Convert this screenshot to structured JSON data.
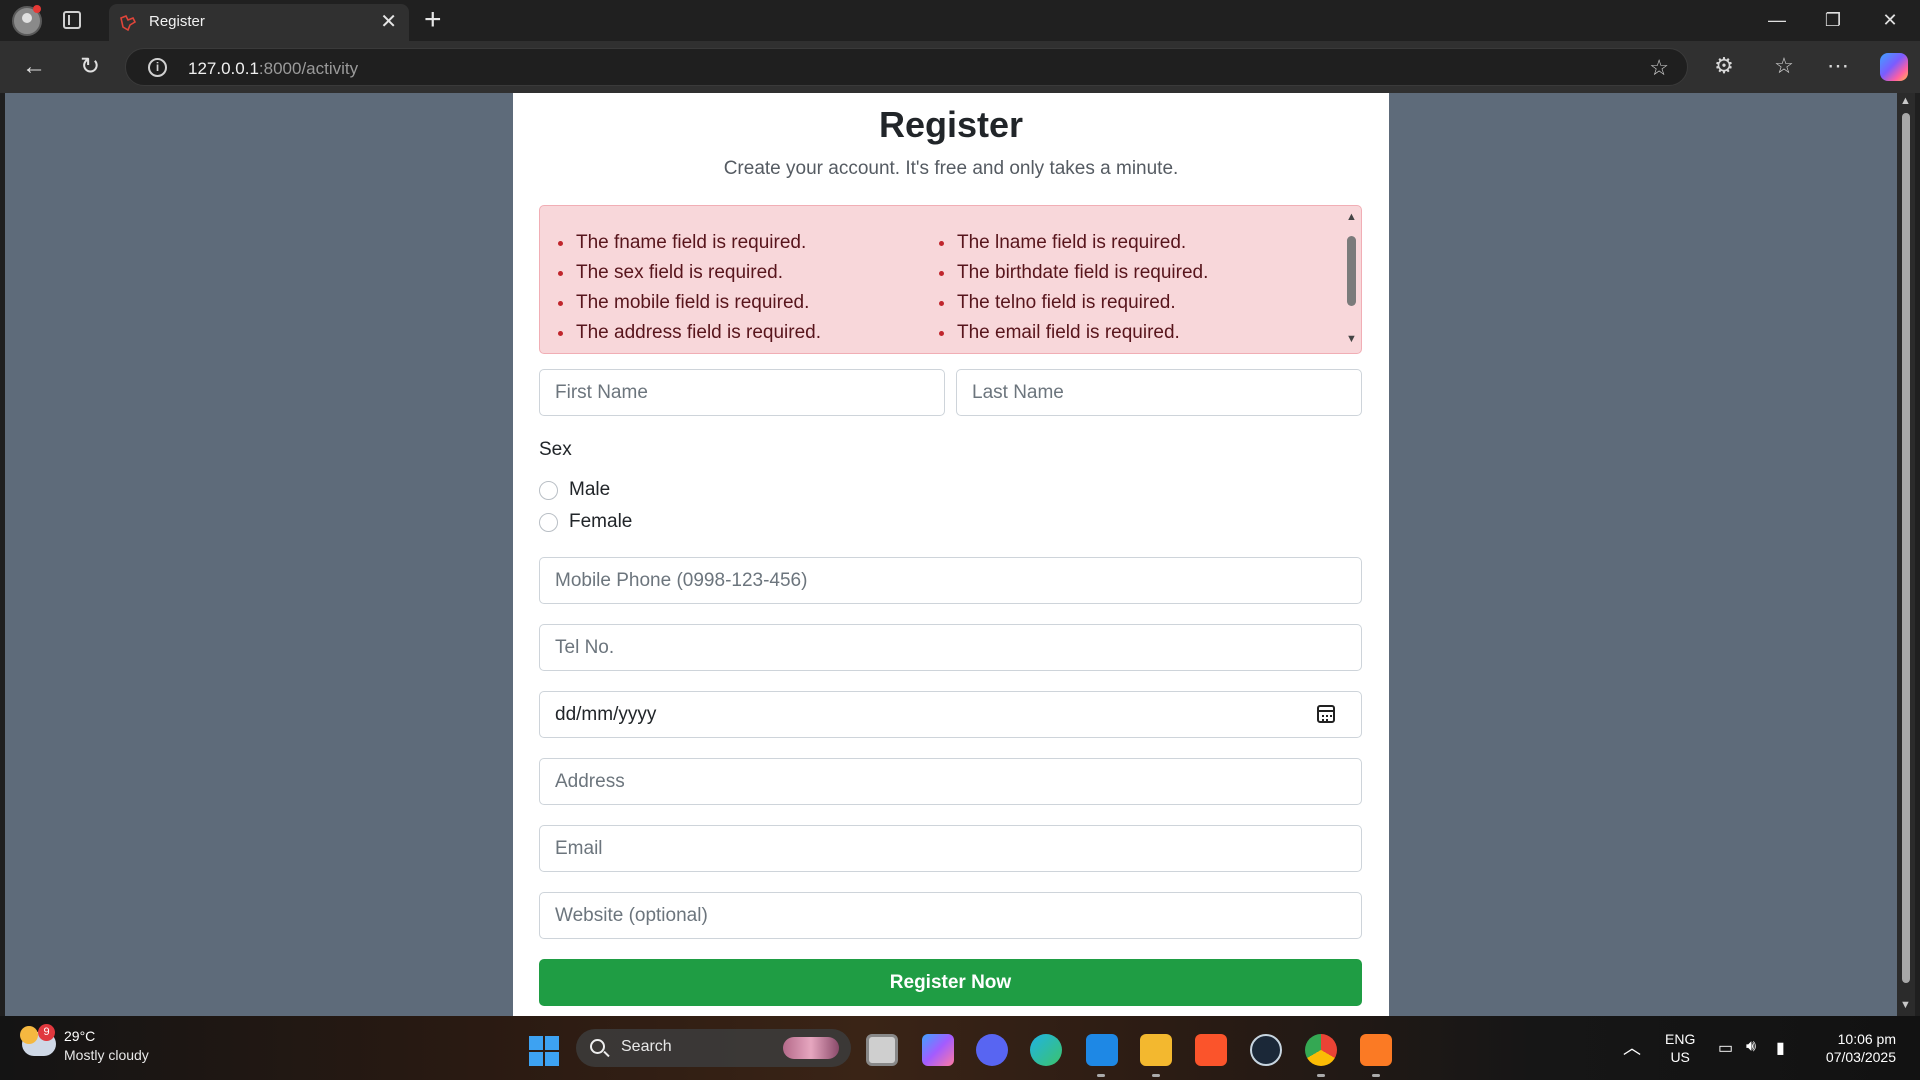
{
  "browser": {
    "tab_title": "Register",
    "url_host": "127.0.0.1",
    "url_path": ":8000/activity"
  },
  "page": {
    "title": "Register",
    "subtitle": "Create your account. It's free and only takes a minute.",
    "errors_left": [
      "The fname field is required.",
      "The sex field is required.",
      "The mobile field is required.",
      "The address field is required."
    ],
    "errors_right": [
      "The lname field is required.",
      "The birthdate field is required.",
      "The telno field is required.",
      "The email field is required."
    ],
    "first_name_placeholder": "First Name",
    "last_name_placeholder": "Last Name",
    "sex_label": "Sex",
    "sex_options": [
      "Male",
      "Female"
    ],
    "mobile_placeholder": "Mobile Phone (0998-123-456)",
    "tel_placeholder": "Tel No.",
    "birthdate_value": "dd/mm/yyyy",
    "address_placeholder": "Address",
    "email_placeholder": "Email",
    "website_placeholder": "Website (optional)",
    "submit_label": "Register Now"
  },
  "taskbar": {
    "weather_badge": "9",
    "weather_temp": "29°C",
    "weather_desc": "Mostly cloudy",
    "search_label": "Search",
    "lang_line1": "ENG",
    "lang_line2": "US",
    "time": "10:06 pm",
    "date": "07/03/2025"
  },
  "colors": {
    "page_bg": "#5e6b7a",
    "alert_bg": "#f8d7da",
    "button": "#1f9d44"
  },
  "icons": [
    "profile-icon",
    "tab-actions-icon",
    "laravel-favicon",
    "close-icon",
    "plus-icon",
    "minimize-icon",
    "maximize-icon",
    "back-icon",
    "reload-icon",
    "info-icon",
    "star-icon",
    "extensions-icon",
    "favorites-icon",
    "more-icon",
    "copilot-icon",
    "calendar-icon",
    "windows-start-icon",
    "search-icon"
  ]
}
